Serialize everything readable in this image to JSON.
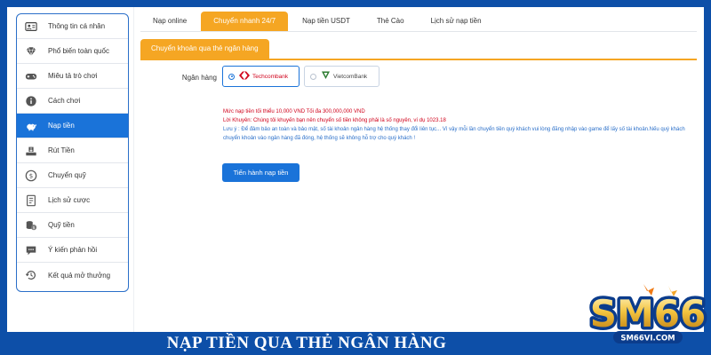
{
  "sidebar": {
    "items": [
      {
        "label": "Thông tin cá nhân",
        "icon": "user-card-icon"
      },
      {
        "label": "Phổ biến toàn quốc",
        "icon": "diamond-icon"
      },
      {
        "label": "Miêu tả trò chơi",
        "icon": "gamepad-icon"
      },
      {
        "label": "Cách chơi",
        "icon": "info-icon"
      },
      {
        "label": "Nạp tiền",
        "icon": "piggy-bank-icon",
        "active": true
      },
      {
        "label": "Rút Tiền",
        "icon": "withdraw-icon"
      },
      {
        "label": "Chuyển quỹ",
        "icon": "transfer-icon"
      },
      {
        "label": "Lịch sử cược",
        "icon": "history-doc-icon"
      },
      {
        "label": "Quỹ tiền",
        "icon": "coins-icon"
      },
      {
        "label": "Ý kiến phản hồi",
        "icon": "feedback-icon"
      },
      {
        "label": "Kết quả mở thưởng",
        "icon": "clock-history-icon"
      }
    ]
  },
  "tabs": [
    "Nạp online",
    "Chuyển nhanh 24/7",
    "Nạp tiền USDT",
    "Thẻ Cào",
    "Lịch sử nạp tiền"
  ],
  "active_tab": "Chuyển nhanh 24/7",
  "section_title": "Chuyển khoản qua thẻ ngân hàng",
  "bank_label": "Ngân hàng",
  "banks": [
    {
      "name": "Techcombank",
      "selected": true,
      "color": "#d0021b"
    },
    {
      "name": "VietcomBank",
      "selected": false,
      "color": "#2e7d32"
    }
  ],
  "notes": {
    "limit": "Mức nạp tiền tối thiểu 10,000 VND Tối đa 300,000,000 VND",
    "advice": "Lời Khuyên: Chúng tôi khuyến bạn nên chuyển số tiền không phải là số nguyên, ví dụ 1023.18",
    "note": "Lưu ý : Để đảm bảo an toàn và bảo mật, số tài khoản ngân hàng hệ thống thay đổi liên tục... Vì vậy mỗi lần chuyển tiền quý khách vui lòng đăng nhập vào game để lấy số tài khoản.Nếu quý khách chuyển khoản vào ngân hàng đã đóng, hệ thống sẽ không hỗ trợ cho quý khách !"
  },
  "submit_label": "Tiến hành nạp tiền",
  "caption": "NẠP TIỀN QUA THẺ NGÂN HÀNG",
  "logo": {
    "text": "SM66",
    "url_text": "SM66VI.COM"
  },
  "colors": {
    "accent": "#f5a623",
    "primary": "#1a73d9",
    "background": "#0d4fa8",
    "warning": "#d0021b"
  }
}
